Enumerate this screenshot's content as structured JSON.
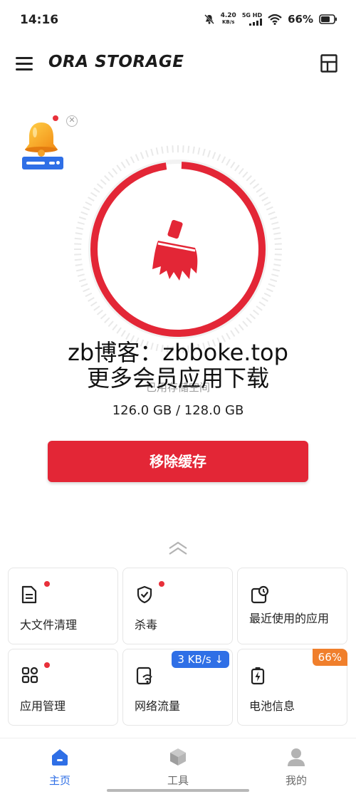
{
  "status_bar": {
    "time": "14:16",
    "net_speed_value": "4.20",
    "net_speed_unit": "KB/s",
    "network_tag": "5G HD",
    "battery": "66%"
  },
  "header": {
    "title": "ORA STORAGE",
    "menu_icon": "hamburger-menu-icon",
    "layout_icon": "dashboard-layout-icon"
  },
  "ad_widget": {
    "icon": "bell-icon",
    "close_icon": "close-icon"
  },
  "gauge": {
    "used_fraction": 0.984,
    "icon": "broom-icon",
    "accent_color": "#e32636"
  },
  "watermark": {
    "line1": "zb博客：zbboke.top",
    "line2": "更多会员应用下载"
  },
  "storage": {
    "label": "已用存储空间",
    "value": "126.0 GB / 128.0 GB"
  },
  "primary_action": {
    "label": "移除缓存"
  },
  "tools": [
    {
      "label": "大文件清理",
      "icon": "document-icon",
      "has_dot": true
    },
    {
      "label": "杀毒",
      "icon": "shield-check-icon",
      "has_dot": true
    },
    {
      "label": "最近使用的应用",
      "icon": "recent-clock-icon",
      "has_dot": false
    },
    {
      "label": "应用管理",
      "icon": "apps-grid-icon",
      "has_dot": true
    },
    {
      "label": "网络流量",
      "icon": "network-traffic-icon",
      "badge": "3 KB/s ↓",
      "badge_color": "#2f6fe6"
    },
    {
      "label": "电池信息",
      "icon": "battery-icon",
      "badge": "66%",
      "badge_color": "#f07f2c"
    }
  ],
  "bottom_nav": [
    {
      "label": "主页",
      "icon": "home-icon",
      "active": true
    },
    {
      "label": "工具",
      "icon": "cube-icon",
      "active": false
    },
    {
      "label": "我的",
      "icon": "person-icon",
      "active": false
    }
  ],
  "colors": {
    "accent": "#e32636",
    "blue": "#2f6fe6",
    "orange": "#f07f2c"
  }
}
